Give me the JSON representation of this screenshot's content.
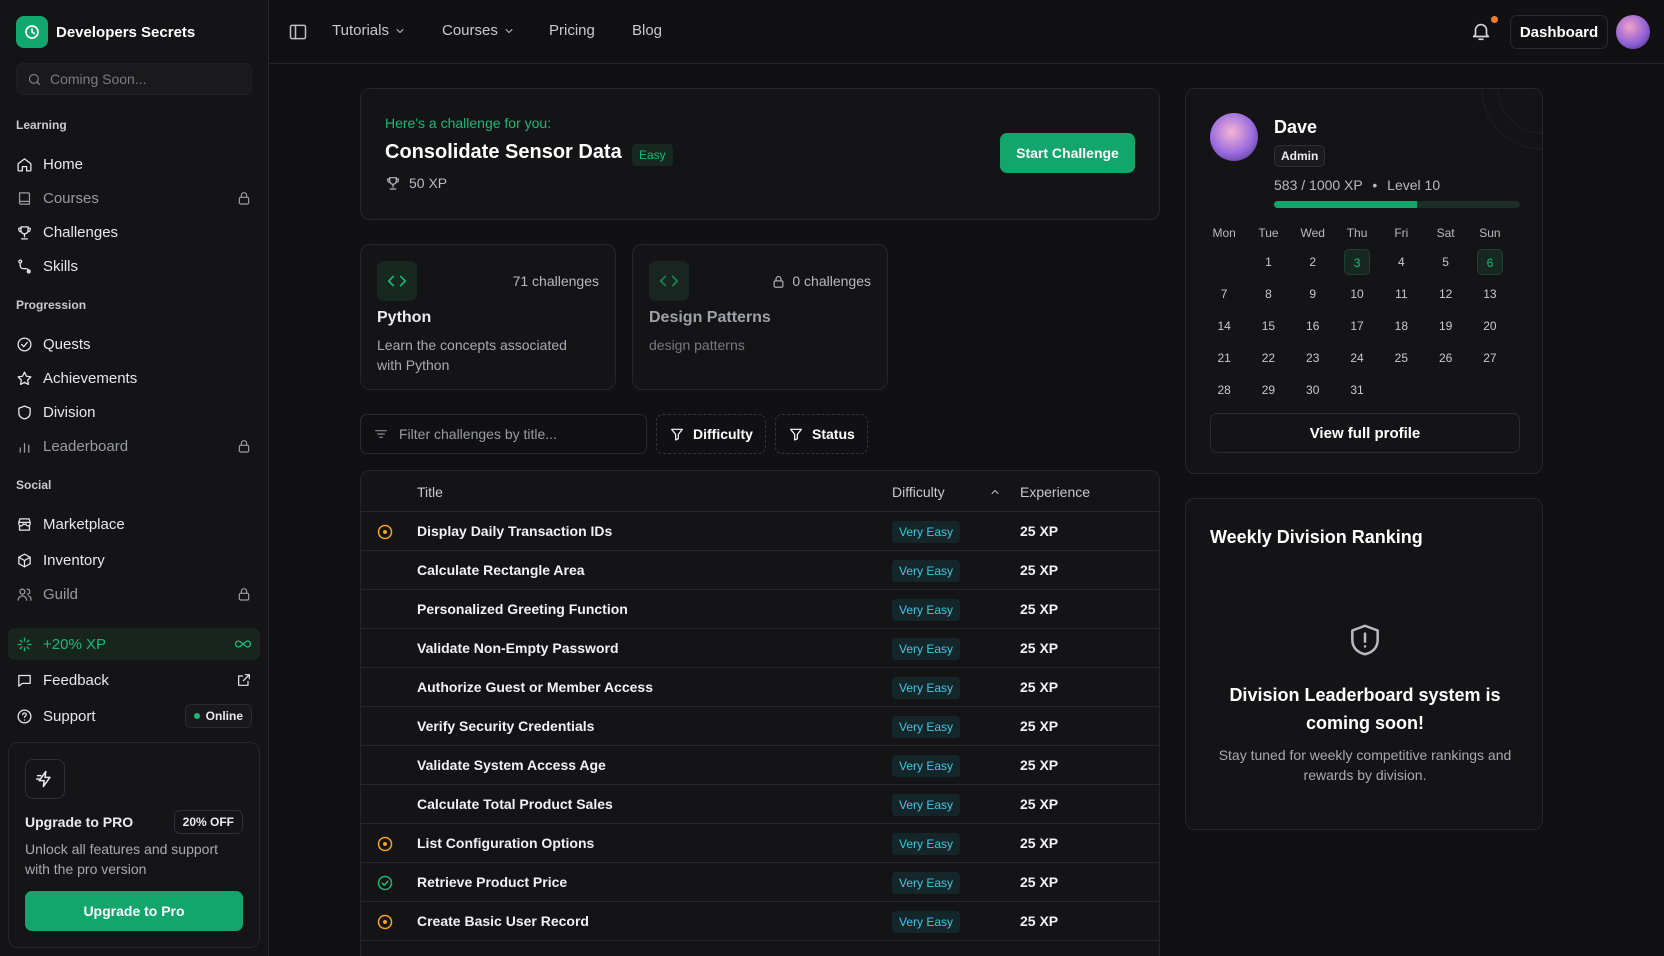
{
  "brand": {
    "name": "Developers Secrets"
  },
  "sidebar": {
    "search_placeholder": "Coming Soon...",
    "sections": {
      "learning": "Learning",
      "progression": "Progression",
      "social": "Social"
    },
    "items": {
      "home": "Home",
      "courses": "Courses",
      "challenges": "Challenges",
      "skills": "Skills",
      "quests": "Quests",
      "achievements": "Achievements",
      "division": "Division",
      "leaderboard": "Leaderboard",
      "marketplace": "Marketplace",
      "inventory": "Inventory",
      "guild": "Guild",
      "xp_boost": "+20% XP",
      "feedback": "Feedback",
      "support": "Support"
    },
    "support_status": "Online",
    "pro": {
      "title": "Upgrade to PRO",
      "discount": "20% OFF",
      "description": "Unlock all features and support with the pro version",
      "button": "Upgrade to Pro"
    }
  },
  "topnav": {
    "tutorials": "Tutorials",
    "courses": "Courses",
    "pricing": "Pricing",
    "blog": "Blog",
    "dashboard": "Dashboard"
  },
  "challenge": {
    "kicker": "Here's a challenge for you:",
    "title": "Consolidate Sensor Data",
    "difficulty": "Easy",
    "xp": "50 XP",
    "button": "Start Challenge"
  },
  "skills": [
    {
      "title": "Python",
      "count": "71 challenges",
      "description": "Learn the concepts associated with Python"
    },
    {
      "title": "Design Patterns",
      "count": "0 challenges",
      "description": "design patterns"
    }
  ],
  "filters": {
    "placeholder": "Filter challenges by title...",
    "difficulty": "Difficulty",
    "status": "Status"
  },
  "table": {
    "headers": {
      "title": "Title",
      "difficulty": "Difficulty",
      "experience": "Experience"
    },
    "rows": [
      {
        "title": "Display Daily Transaction IDs",
        "difficulty": "Very Easy",
        "xp": "25 XP",
        "status": "in-progress"
      },
      {
        "title": "Calculate Rectangle Area",
        "difficulty": "Very Easy",
        "xp": "25 XP",
        "status": "none"
      },
      {
        "title": "Personalized Greeting Function",
        "difficulty": "Very Easy",
        "xp": "25 XP",
        "status": "none"
      },
      {
        "title": "Validate Non-Empty Password",
        "difficulty": "Very Easy",
        "xp": "25 XP",
        "status": "none"
      },
      {
        "title": "Authorize Guest or Member Access",
        "difficulty": "Very Easy",
        "xp": "25 XP",
        "status": "none"
      },
      {
        "title": "Verify Security Credentials",
        "difficulty": "Very Easy",
        "xp": "25 XP",
        "status": "none"
      },
      {
        "title": "Validate System Access Age",
        "difficulty": "Very Easy",
        "xp": "25 XP",
        "status": "none"
      },
      {
        "title": "Calculate Total Product Sales",
        "difficulty": "Very Easy",
        "xp": "25 XP",
        "status": "none"
      },
      {
        "title": "List Configuration Options",
        "difficulty": "Very Easy",
        "xp": "25 XP",
        "status": "in-progress"
      },
      {
        "title": "Retrieve Product Price",
        "difficulty": "Very Easy",
        "xp": "25 XP",
        "status": "completed"
      },
      {
        "title": "Create Basic User Record",
        "difficulty": "Very Easy",
        "xp": "25 XP",
        "status": "in-progress"
      }
    ]
  },
  "profile": {
    "name": "Dave",
    "role": "Admin",
    "xp_text": "583 / 1000 XP",
    "level": "Level 10",
    "xp_progress": 0.583,
    "weekdays": [
      "Mon",
      "Tue",
      "Wed",
      "Thu",
      "Fri",
      "Sat",
      "Sun"
    ],
    "calendar": [
      [
        "",
        "1",
        "2",
        "3",
        "4",
        "5",
        "6"
      ],
      [
        "7",
        "8",
        "9",
        "10",
        "11",
        "12",
        "13"
      ],
      [
        "14",
        "15",
        "16",
        "17",
        "18",
        "19",
        "20"
      ],
      [
        "21",
        "22",
        "23",
        "24",
        "25",
        "26",
        "27"
      ],
      [
        "28",
        "29",
        "30",
        "31",
        "",
        "",
        ""
      ]
    ],
    "active_days": [
      "3",
      "6"
    ],
    "button": "View full profile"
  },
  "ranking": {
    "title": "Weekly Division Ranking",
    "headline": "Division Leaderboard system is coming soon!",
    "description": "Stay tuned for weekly competitive rankings and rewards by division."
  },
  "colors": {
    "accent": "#12a56c",
    "accent_text": "#16b97a",
    "in_progress": "#f5a524",
    "very_easy": "#3fc7e0",
    "background": "#111113"
  }
}
